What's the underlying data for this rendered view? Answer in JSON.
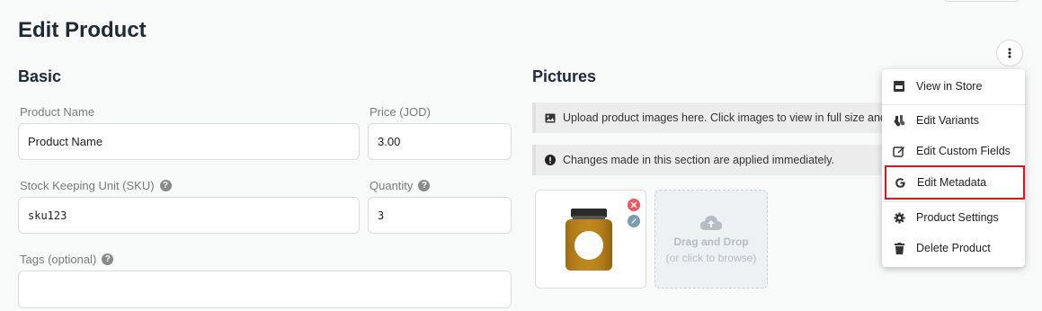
{
  "page": {
    "title": "Edit Product"
  },
  "basic": {
    "heading": "Basic",
    "product_name": {
      "label": "Product Name",
      "value": "Product Name"
    },
    "price": {
      "label": "Price (JOD)",
      "value": "3.00"
    },
    "sku": {
      "label": "Stock Keeping Unit (SKU)",
      "value": "sku123"
    },
    "quantity": {
      "label": "Quantity",
      "value": "3"
    },
    "tags": {
      "label": "Tags (optional)",
      "value": ""
    }
  },
  "pictures": {
    "heading": "Pictures",
    "upload_notice": "Upload product images here. Click images to view in full size and dra",
    "changes_notice": "Changes made in this section are applied immediately.",
    "dropzone": {
      "title": "Drag and Drop",
      "subtitle": "(or click to browse)"
    }
  },
  "menu": {
    "items": [
      {
        "label": "View in Store",
        "icon": "store-icon"
      },
      {
        "label": "Edit Variants",
        "icon": "socks-icon"
      },
      {
        "label": "Edit Custom Fields",
        "icon": "edit-icon"
      },
      {
        "label": "Edit Metadata",
        "icon": "google-icon"
      },
      {
        "label": "Product Settings",
        "icon": "gear-icon"
      },
      {
        "label": "Delete Product",
        "icon": "trash-icon"
      }
    ]
  },
  "colors": {
    "highlight": "#e0151f",
    "delete_badge": "#f2545b",
    "edit_badge": "#7a9bb5"
  }
}
